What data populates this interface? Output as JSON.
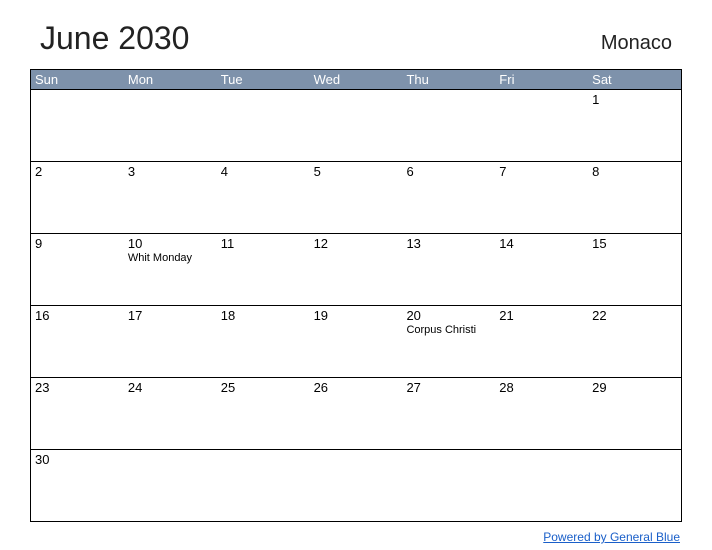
{
  "header": {
    "title": "June 2030",
    "location": "Monaco"
  },
  "weekdays": [
    "Sun",
    "Mon",
    "Tue",
    "Wed",
    "Thu",
    "Fri",
    "Sat"
  ],
  "weeks": [
    [
      {
        "day": "",
        "event": ""
      },
      {
        "day": "",
        "event": ""
      },
      {
        "day": "",
        "event": ""
      },
      {
        "day": "",
        "event": ""
      },
      {
        "day": "",
        "event": ""
      },
      {
        "day": "",
        "event": ""
      },
      {
        "day": "1",
        "event": ""
      }
    ],
    [
      {
        "day": "2",
        "event": ""
      },
      {
        "day": "3",
        "event": ""
      },
      {
        "day": "4",
        "event": ""
      },
      {
        "day": "5",
        "event": ""
      },
      {
        "day": "6",
        "event": ""
      },
      {
        "day": "7",
        "event": ""
      },
      {
        "day": "8",
        "event": ""
      }
    ],
    [
      {
        "day": "9",
        "event": ""
      },
      {
        "day": "10",
        "event": "Whit Monday"
      },
      {
        "day": "11",
        "event": ""
      },
      {
        "day": "12",
        "event": ""
      },
      {
        "day": "13",
        "event": ""
      },
      {
        "day": "14",
        "event": ""
      },
      {
        "day": "15",
        "event": ""
      }
    ],
    [
      {
        "day": "16",
        "event": ""
      },
      {
        "day": "17",
        "event": ""
      },
      {
        "day": "18",
        "event": ""
      },
      {
        "day": "19",
        "event": ""
      },
      {
        "day": "20",
        "event": "Corpus Christi"
      },
      {
        "day": "21",
        "event": ""
      },
      {
        "day": "22",
        "event": ""
      }
    ],
    [
      {
        "day": "23",
        "event": ""
      },
      {
        "day": "24",
        "event": ""
      },
      {
        "day": "25",
        "event": ""
      },
      {
        "day": "26",
        "event": ""
      },
      {
        "day": "27",
        "event": ""
      },
      {
        "day": "28",
        "event": ""
      },
      {
        "day": "29",
        "event": ""
      }
    ],
    [
      {
        "day": "30",
        "event": ""
      },
      {
        "day": "",
        "event": ""
      },
      {
        "day": "",
        "event": ""
      },
      {
        "day": "",
        "event": ""
      },
      {
        "day": "",
        "event": ""
      },
      {
        "day": "",
        "event": ""
      },
      {
        "day": "",
        "event": ""
      }
    ]
  ],
  "footer": {
    "link_text": "Powered by General Blue"
  }
}
